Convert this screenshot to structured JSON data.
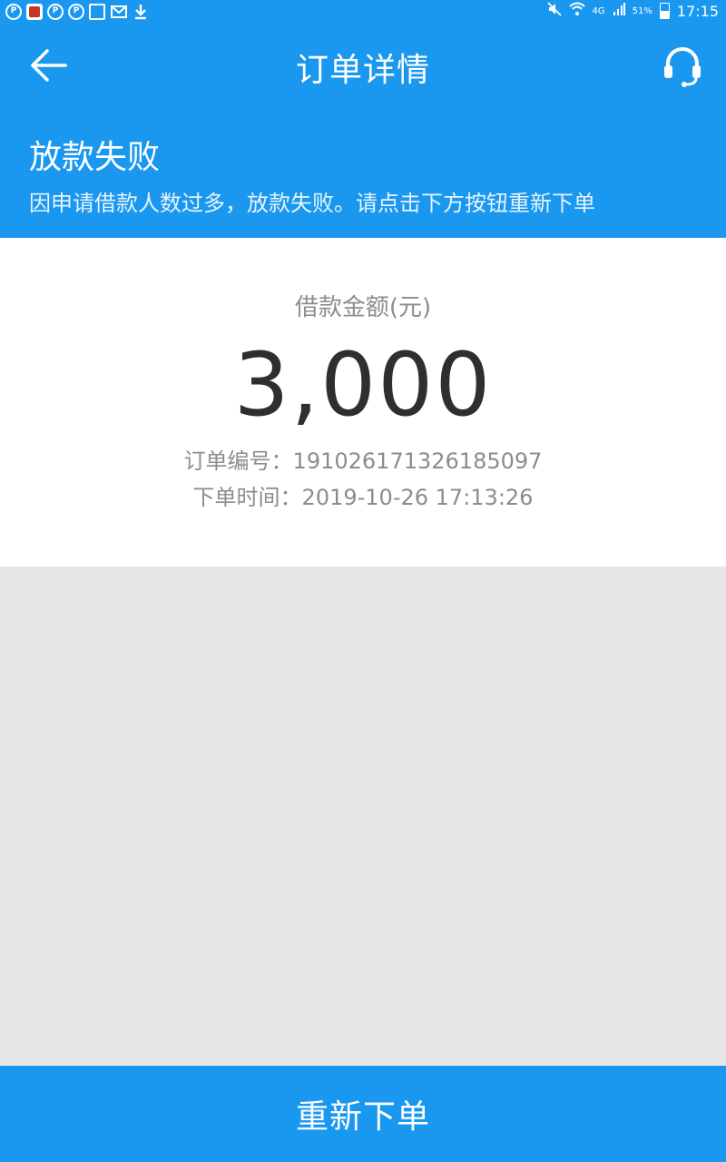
{
  "status_bar": {
    "network": "4G",
    "battery": "51%",
    "time": "17:15"
  },
  "header": {
    "title": "订单详情"
  },
  "status": {
    "title": "放款失败",
    "description": "因申请借款人数过多，放款失败。请点击下方按钮重新下单"
  },
  "loan": {
    "amount_label": "借款金额(元)",
    "amount": "3,000",
    "order_no": "订单编号：191026171326185097",
    "order_time": "下单时间：2019-10-26 17:13:26"
  },
  "actions": {
    "reorder_label": "重新下单"
  },
  "colors": {
    "primary": "#1a98f0",
    "background": "#e6e6e6",
    "text_dark": "#2f2f2f",
    "text_muted": "#8c8c8c"
  }
}
